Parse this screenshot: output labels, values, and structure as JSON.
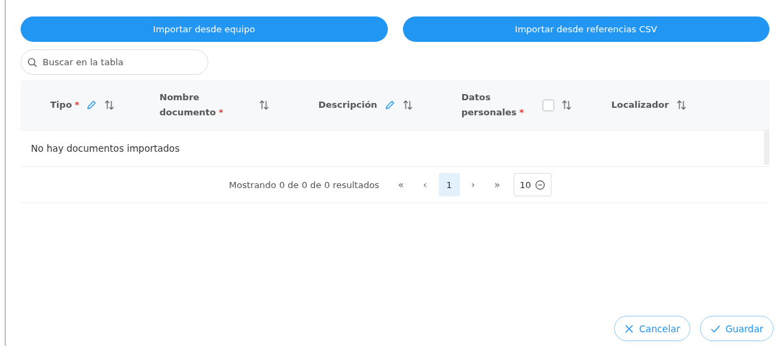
{
  "import_buttons": [
    "Importar desde equipo",
    "Importar desde referencias CSV"
  ],
  "search": {
    "placeholder": "Buscar en la tabla"
  },
  "table": {
    "columns": [
      {
        "kind": "editable",
        "label": "Tipo",
        "required_mark": "*"
      },
      {
        "kind": "plain",
        "label": "Nombre documento",
        "required_mark": "*"
      },
      {
        "kind": "editable",
        "label": "Descripción"
      },
      {
        "kind": "checkbox",
        "label": "Datos personales",
        "required_mark": "*",
        "checked": false
      },
      {
        "kind": "plain",
        "label": "Localizador"
      }
    ],
    "empty_message": "No hay documentos importados"
  },
  "pagination": {
    "summary": "Mostrando 0 de 0 de 0 resultados",
    "first": "«",
    "prev": "‹",
    "pages": [
      {
        "label": "1",
        "selected": true
      }
    ],
    "next": "›",
    "last": "»",
    "page_size": "10"
  },
  "actions": [
    {
      "kind": "cancel",
      "label": "Cancelar"
    },
    {
      "kind": "save",
      "label": "Guardar"
    }
  ]
}
